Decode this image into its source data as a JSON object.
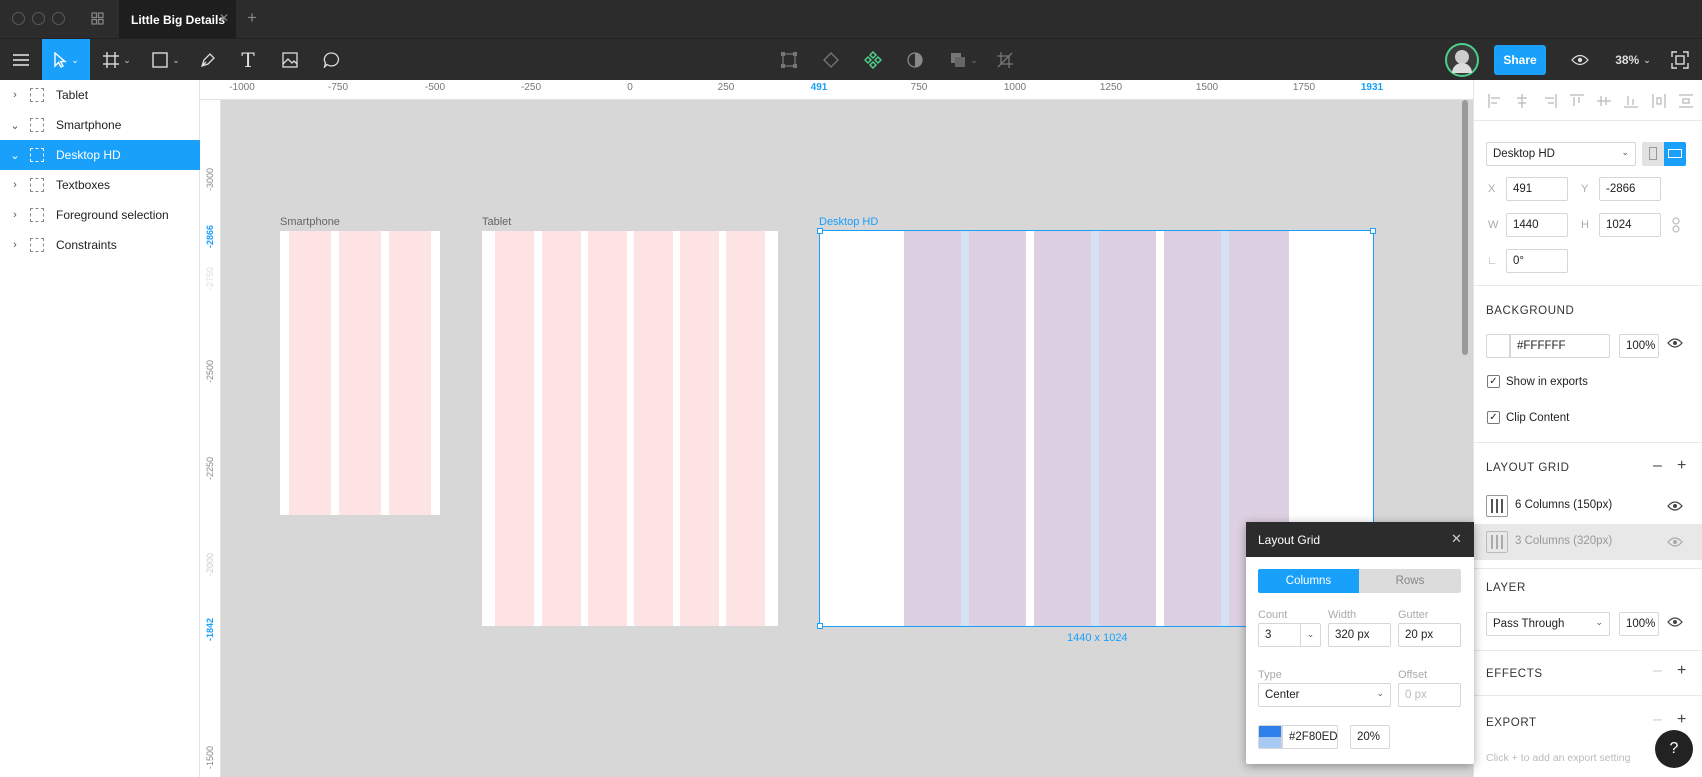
{
  "window": {
    "tab_title": "Little Big Details",
    "new_tab": "+"
  },
  "toolbar": {
    "share": "Share",
    "zoom": "38%"
  },
  "layers": [
    {
      "label": "Tablet",
      "chev": "›"
    },
    {
      "label": "Smartphone",
      "chev": "⌄"
    },
    {
      "label": "Desktop HD",
      "chev": "⌄"
    },
    {
      "label": "Textboxes",
      "chev": "›"
    },
    {
      "label": "Foreground selection",
      "chev": "›"
    },
    {
      "label": "Constraints",
      "chev": "›"
    }
  ],
  "ruler_h": [
    "-1000",
    "-750",
    "-500",
    "-250",
    "0",
    "250",
    "491",
    "750",
    "1000",
    "1250",
    "1500",
    "1750",
    "1931"
  ],
  "ruler_v": [
    "-3000",
    "-2866",
    "-2750",
    "-2500",
    "-2250",
    "-2000",
    "-1842",
    "-1500"
  ],
  "canvas": {
    "smartphone_label": "Smartphone",
    "tablet_label": "Tablet",
    "desktop_label": "Desktop HD",
    "desktop_size": "1440 x 1024"
  },
  "props": {
    "frame_preset": "Desktop HD",
    "x_label": "X",
    "x": "491",
    "y_label": "Y",
    "y": "-2866",
    "w_label": "W",
    "w": "1440",
    "h_label": "H",
    "h": "1024",
    "rotation": "0°",
    "background": {
      "title": "BACKGROUND",
      "hex": "#FFFFFF",
      "opacity": "100%",
      "show_in_exports": "Show in exports",
      "clip_content": "Clip Content"
    },
    "layout_grid": {
      "title": "LAYOUT GRID",
      "items": [
        "6 Columns (150px)",
        "3 Columns (320px)"
      ]
    },
    "layer": {
      "title": "LAYER",
      "blend": "Pass Through",
      "opacity": "100%"
    },
    "effects": {
      "title": "EFFECTS"
    },
    "export": {
      "title": "EXPORT",
      "hint": "Click + to add an export setting"
    }
  },
  "popup": {
    "title": "Layout Grid",
    "tab_columns": "Columns",
    "tab_rows": "Rows",
    "count_label": "Count",
    "count": "3",
    "width_label": "Width",
    "width": "320 px",
    "gutter_label": "Gutter",
    "gutter": "20 px",
    "type_label": "Type",
    "type": "Center",
    "offset_label": "Offset",
    "offset": "0 px",
    "color_hex": "#2F80ED",
    "color_opacity": "20%"
  },
  "help": "?",
  "colors": {
    "accent": "#18a0fb",
    "grid": "#2F80ED",
    "column_tint": "#fde3e3"
  }
}
